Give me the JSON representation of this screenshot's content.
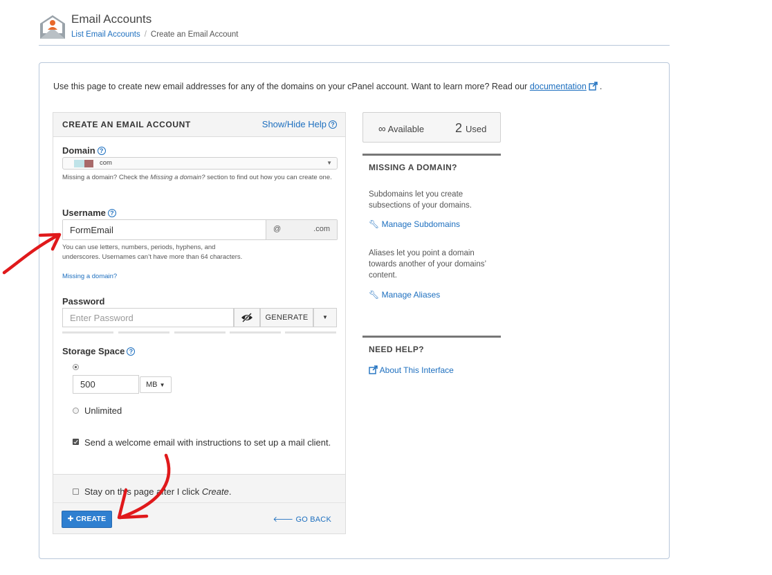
{
  "header": {
    "title": "Email Accounts",
    "breadcrumb": {
      "link": "List Email Accounts",
      "separator": "/",
      "current": "Create an Email Account"
    }
  },
  "intro": {
    "text": "Use this page to create new email addresses for any of the domains on your cPanel account. Want to learn more? Read our",
    "link": "documentation",
    "suffix": "."
  },
  "form": {
    "heading": "CREATE AN EMAIL ACCOUNT",
    "help_toggle": "Show/Hide Help",
    "domain": {
      "label": "Domain",
      "selected": "com",
      "hint_a": "Missing a domain? Check the ",
      "hint_em": "Missing a domain?",
      "hint_b": " section to find out how you can create one."
    },
    "username": {
      "label": "Username",
      "value": "FormEmail",
      "at": "@",
      "domain_suffix": ".com",
      "hint": "You can use letters, numbers, periods, hyphens, and underscores. Usernames can’t have more than 64 characters.",
      "missing_link": "Missing a domain?"
    },
    "password": {
      "label": "Password",
      "placeholder": "Enter Password",
      "generate": "GENERATE"
    },
    "storage": {
      "label": "Storage Space",
      "value": "500",
      "unit": "MB",
      "unlimited": "Unlimited"
    },
    "welcome_email": "Send a welcome email with instructions to set up a mail client.",
    "stay_pre": "Stay on this page after I click ",
    "stay_em": "Create",
    "stay_post": ".",
    "create": "CREATE",
    "go_back": "GO BACK"
  },
  "sidebar": {
    "available_symbol": "∞",
    "available_label": "Available",
    "used_count": "2",
    "used_label": "Used",
    "missing_heading": "MISSING A DOMAIN?",
    "subdomains_text": "Subdomains let you create subsections of your domains.",
    "manage_subdomains": "Manage Subdomains",
    "aliases_text": "Aliases let you point a domain towards another of your domains’ content.",
    "manage_aliases": "Manage Aliases",
    "help_heading": "NEED HELP?",
    "about": "About This Interface"
  },
  "colors": {
    "link": "#1d6fbf",
    "primary_button": "#2f7fd0",
    "annotation_arrow": "#e0191b",
    "icon_orange": "#e8692b"
  },
  "icons": [
    "envelope-user-icon",
    "external-link-icon",
    "question-circle-icon",
    "eye-slash-icon",
    "caret-down-icon",
    "plus-icon",
    "arrow-left-icon",
    "wrench-icon"
  ]
}
